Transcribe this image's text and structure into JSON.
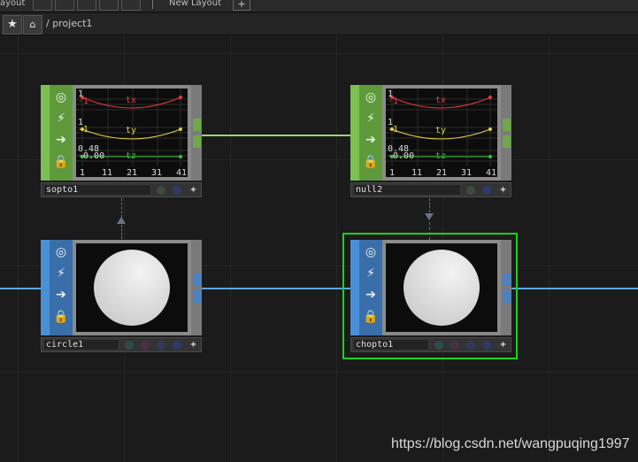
{
  "topbar": {
    "layout_label": "ayout",
    "new_layout_label": "New Layout",
    "add_label": "+"
  },
  "pathbar": {
    "star_icon": "star-icon",
    "home_icon": "home-icon",
    "path": "/ project1"
  },
  "colors": {
    "sop": "#6ea848",
    "chop": "#4a82c4",
    "wire_sop": "#9ed27a",
    "wire_chop": "#58a6e8",
    "selected": "#19d319"
  },
  "nodes": [
    {
      "name": "sopto1",
      "family": "SOP",
      "selected": false,
      "channels": [
        {
          "name": "tx",
          "top": "1",
          "bottom": "-1",
          "color": "#e03a3a"
        },
        {
          "name": "ty",
          "top": "1",
          "bottom": "-1",
          "color": "#e0d23a"
        },
        {
          "name": "tz",
          "top": "0.48",
          "bottom": "-0.00",
          "color": "#2ec62e"
        }
      ],
      "x_ticks": [
        "1",
        "11",
        "21",
        "31",
        "41"
      ]
    },
    {
      "name": "null2",
      "family": "SOP",
      "selected": false,
      "channels": [
        {
          "name": "tx",
          "top": "1",
          "bottom": "-1",
          "color": "#e03a3a"
        },
        {
          "name": "ty",
          "top": "1",
          "bottom": "-1",
          "color": "#e0d23a"
        },
        {
          "name": "tz",
          "top": "0.48",
          "bottom": "-0.00",
          "color": "#2ec62e"
        }
      ],
      "x_ticks": [
        "1",
        "11",
        "21",
        "31",
        "41"
      ]
    },
    {
      "name": "circle1",
      "family": "CHOP",
      "selected": false
    },
    {
      "name": "chopto1",
      "family": "CHOP",
      "selected": true
    }
  ],
  "watermark": "https://blog.csdn.net/wangpuqing1997"
}
